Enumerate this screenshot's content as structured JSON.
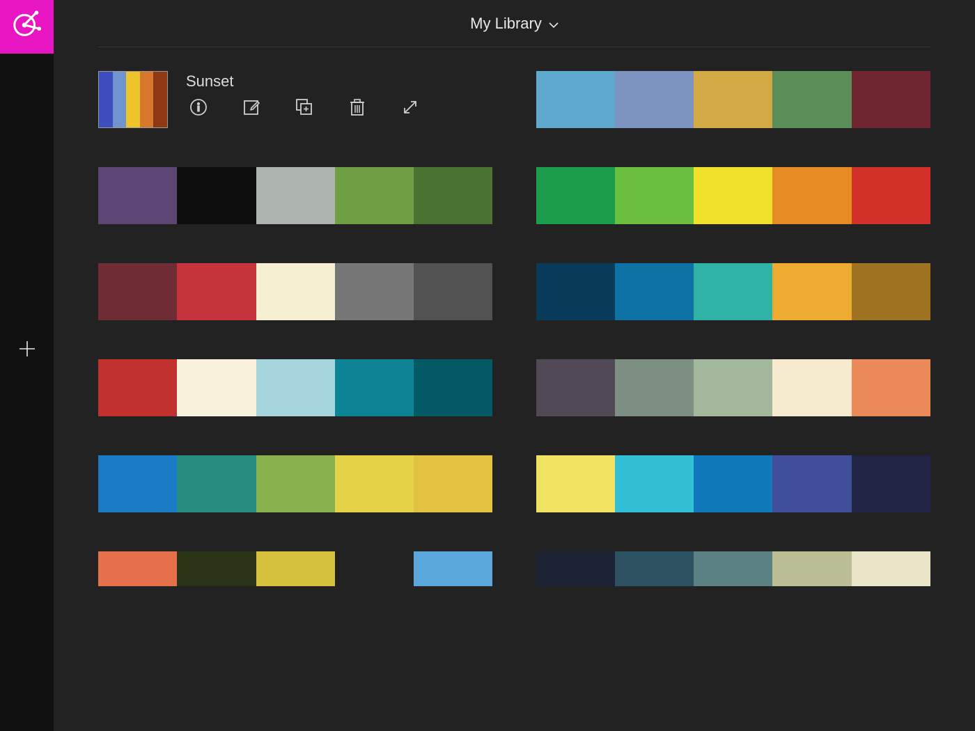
{
  "sidebar": {
    "add_label": "Add"
  },
  "header": {
    "library_label": "My Library"
  },
  "selected": {
    "name": "Sunset",
    "thumb_colors": [
      "#3f4ebf",
      "#6f94d0",
      "#edc52b",
      "#d9782c",
      "#8e3914"
    ]
  },
  "left_palettes": [
    [
      "#5b4673",
      "#0e0e0e",
      "#aeb5b0",
      "#6ea043",
      "#4a7331"
    ],
    [
      "#6f2c35",
      "#c6343c",
      "#f7efd1",
      "#777777",
      "#525252"
    ],
    [
      "#c1322f",
      "#f8f1dc",
      "#a6d5de",
      "#0d8496",
      "#035a64"
    ],
    [
      "#1a7bc4",
      "#268c7f",
      "#86b24e",
      "#e6d247",
      "#e3c23f"
    ],
    [
      "#e6704c",
      "#2c3417",
      "#d6c13f",
      "#212121",
      "#5aa7db"
    ]
  ],
  "right_palettes": [
    [
      "#5fa9cf",
      "#7e94c0",
      "#d3a946",
      "#5b8d58",
      "#6f2530"
    ],
    [
      "#1a9e4b",
      "#6abf3e",
      "#f2e12a",
      "#e78c24",
      "#d3322b"
    ],
    [
      "#083b59",
      "#0d72a3",
      "#2fb3a6",
      "#eeab32",
      "#a07322"
    ],
    [
      "#514955",
      "#7d8f82",
      "#a3b79c",
      "#f7ebcf",
      "#e98a58"
    ],
    [
      "#f1e262",
      "#33bfd6",
      "#1079b9",
      "#3f4f9a",
      "#212445"
    ],
    [
      "#1b2233",
      "#2c5161",
      "#5b8184",
      "#bcbf95",
      "#eae4c9"
    ]
  ],
  "icons": {
    "info": "info-icon",
    "edit": "edit-icon",
    "duplicate": "duplicate-icon",
    "delete": "trash-icon",
    "expand": "expand-icon"
  }
}
